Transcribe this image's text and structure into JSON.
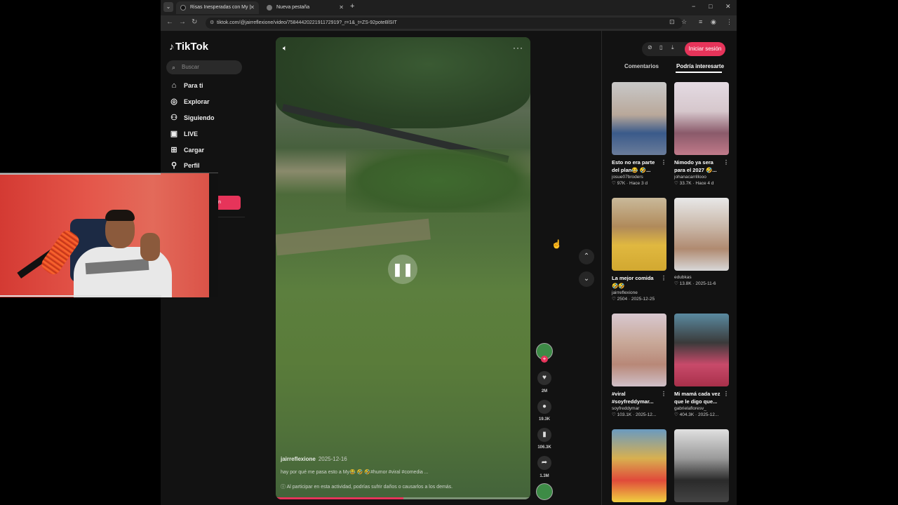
{
  "browser": {
    "tabs": [
      {
        "title": "Risas Inesperadas con My |",
        "active": true
      },
      {
        "title": "Nueva pestaña",
        "active": false
      }
    ],
    "new_tab_label": "+",
    "url": "tiktok.com/@jairreflexione/video/7584442022191172919?_r=1&_t=ZS-92poteBlSIT",
    "window_controls": {
      "minimize": "−",
      "maximize": "□",
      "close": "✕"
    }
  },
  "sidebar": {
    "logo": "TikTok",
    "search_placeholder": "Buscar",
    "items": [
      {
        "label": "Para ti",
        "icon": "home-icon",
        "glyph": "⌂"
      },
      {
        "label": "Explorar",
        "icon": "compass-icon",
        "glyph": "◎"
      },
      {
        "label": "Siguiendo",
        "icon": "following-icon",
        "glyph": "⚇"
      },
      {
        "label": "LIVE",
        "icon": "live-icon",
        "glyph": "▣"
      },
      {
        "label": "Cargar",
        "icon": "upload-icon",
        "glyph": "⊞"
      },
      {
        "label": "Perfil",
        "icon": "profile-icon",
        "glyph": "⚲"
      }
    ],
    "login_partial": "n"
  },
  "video": {
    "author": "jairreflexione",
    "date": "2025-12-16",
    "description": "hay por qué me pasa esto a My😂 🤣 🤣#humor #viral #comedia ...",
    "warning": "Al participar en esta actividad, podrías sufrir daños o causarlos a los demás.",
    "progress": 0.5
  },
  "actions": {
    "likes": "2M",
    "comments": "19.3K",
    "saves": "106.3K",
    "shares": "1.3M"
  },
  "right_panel": {
    "login_label": "Iniciar sesión",
    "tabs": [
      "Comentarios",
      "Podría interesarte"
    ],
    "active_tab": "Podría interesarte",
    "cards": [
      {
        "title": "Esto no era parte del plan😂 🤣...",
        "author": "josue07broders",
        "stats": "♡ 97K · Hace 3 d"
      },
      {
        "title": "Nimodo ya sera para el 2027 🤣...",
        "author": "johanacarrillooo",
        "stats": "♡ 33.7K · Hace 4 d"
      },
      {
        "title": "La mejor comida 🤣🤣",
        "author": "jairreflexione",
        "stats": "♡ 2504 · 2025-12-25"
      },
      {
        "title": "",
        "author": "edubkas",
        "stats": "♡ 13.8K · 2025-11-6"
      },
      {
        "title": "#viral #soyfreddymar...",
        "author": "soyfreddymar",
        "stats": "♡ 103.1K · 2025-12..."
      },
      {
        "title": "Mi mamá cada vez que le digo que...",
        "author": "gabrielafloresv_",
        "stats": "♡ 404.3K · 2025-12..."
      },
      {
        "title": "",
        "author": "",
        "stats": ""
      },
      {
        "title": "",
        "author": "",
        "stats": ""
      }
    ]
  },
  "colors": {
    "accent": "#e6345a",
    "background": "#121212"
  }
}
